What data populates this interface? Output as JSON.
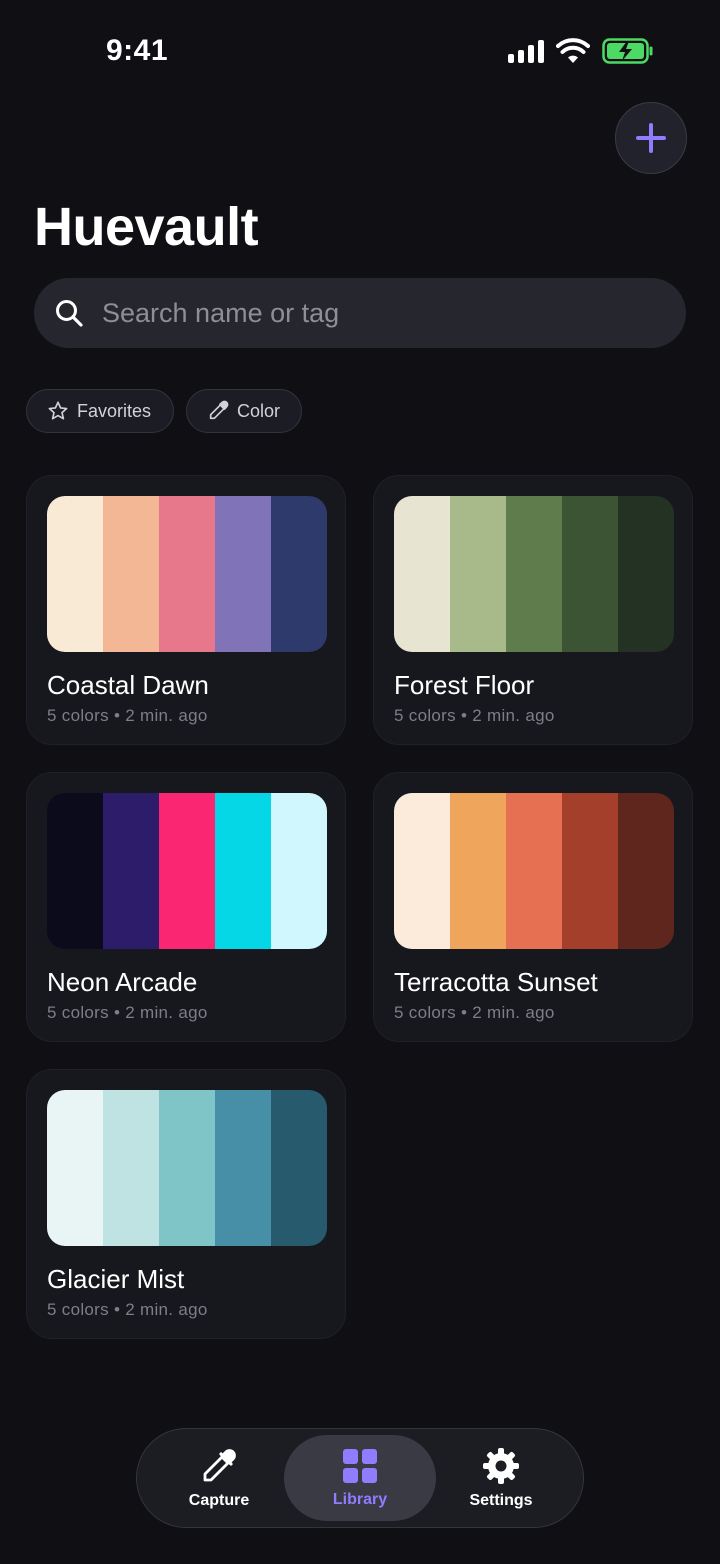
{
  "status_bar": {
    "time": "9:41"
  },
  "header": {
    "title": "Huevault"
  },
  "search": {
    "placeholder": "Search name or tag"
  },
  "filters": [
    {
      "label": "Favorites",
      "icon": "star-icon"
    },
    {
      "label": "Color",
      "icon": "eyedropper-icon"
    }
  ],
  "palettes": [
    {
      "name": "Coastal Dawn",
      "meta": "5 colors • 2 min. ago",
      "colors": [
        "#f8ead4",
        "#f4b795",
        "#e7788c",
        "#8073b7",
        "#2d3a6b"
      ]
    },
    {
      "name": "Forest Floor",
      "meta": "5 colors • 2 min. ago",
      "colors": [
        "#e8e4d2",
        "#a8ba89",
        "#5f7d4c",
        "#3c5433",
        "#243223"
      ]
    },
    {
      "name": "Neon Arcade",
      "meta": "5 colors • 2 min. ago",
      "colors": [
        "#0b0b1c",
        "#2c1c6a",
        "#fb2672",
        "#05d7e6",
        "#d0f7fd"
      ]
    },
    {
      "name": "Terracotta Sunset",
      "meta": "5 colors • 2 min. ago",
      "colors": [
        "#fcebdb",
        "#efa55c",
        "#e57152",
        "#a33f2b",
        "#5e261c"
      ]
    },
    {
      "name": "Glacier Mist",
      "meta": "5 colors • 2 min. ago",
      "colors": [
        "#e8f5f4",
        "#bfe2e2",
        "#7fc5c8",
        "#478fa6",
        "#275a6d"
      ]
    }
  ],
  "tabs": [
    {
      "label": "Capture",
      "icon": "eyedropper-icon"
    },
    {
      "label": "Library",
      "icon": "grid-icon",
      "active": true
    },
    {
      "label": "Settings",
      "icon": "gear-icon"
    }
  ],
  "colors": {
    "accent": "#8f7cff",
    "background": "#0f0f14",
    "card": "#17171e"
  }
}
